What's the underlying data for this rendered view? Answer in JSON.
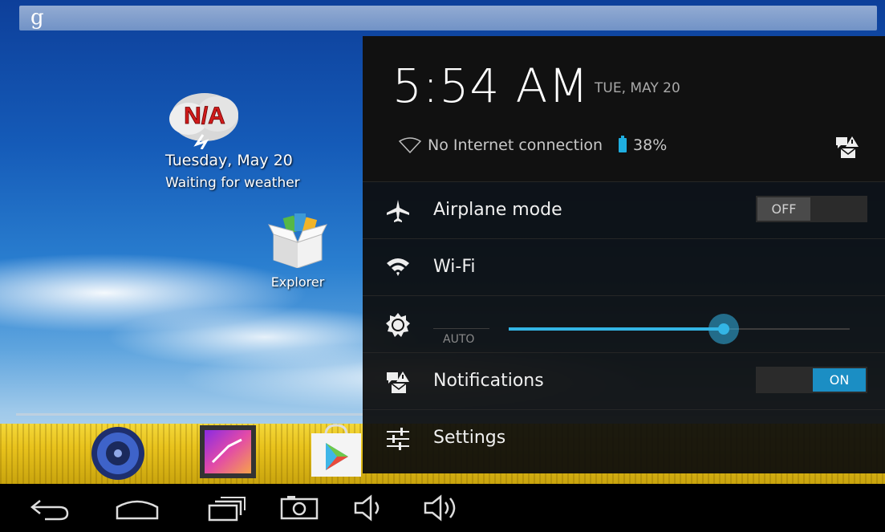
{
  "home": {
    "search_logo": "g",
    "weather": {
      "icon_text": "N/A",
      "date": "Tuesday, May 20",
      "status": "Waiting for weather"
    },
    "apps": [
      {
        "label": "Explorer",
        "icon": "explorer-box-icon"
      }
    ],
    "dock": [
      {
        "icon": "music-speaker-icon"
      },
      {
        "icon": "gallery-icon"
      },
      {
        "icon": "play-store-icon"
      }
    ]
  },
  "panel": {
    "time": "5:54 AM",
    "date": "TUE, MAY 20",
    "connection": "No Internet connection",
    "battery": "38%",
    "battery_level": 0.38,
    "rows": {
      "airplane": {
        "label": "Airplane mode",
        "toggle": "OFF",
        "icon": "airplane-icon"
      },
      "wifi": {
        "label": "Wi-Fi",
        "icon": "wifi-icon"
      },
      "brightness": {
        "auto_label": "AUTO",
        "level": 0.63,
        "icon": "brightness-icon"
      },
      "notifications": {
        "label": "Notifications",
        "toggle": "ON",
        "icon": "notifications-icon"
      },
      "settings": {
        "label": "Settings",
        "icon": "settings-sliders-icon"
      }
    }
  },
  "navbar": {
    "buttons": [
      "back-icon",
      "home-icon",
      "recent-apps-icon",
      "screenshot-icon",
      "volume-down-icon",
      "volume-up-icon"
    ]
  },
  "colors": {
    "accent": "#33b5e5",
    "toggle_on": "#1b8ec4",
    "panel_bg": "#111111"
  }
}
